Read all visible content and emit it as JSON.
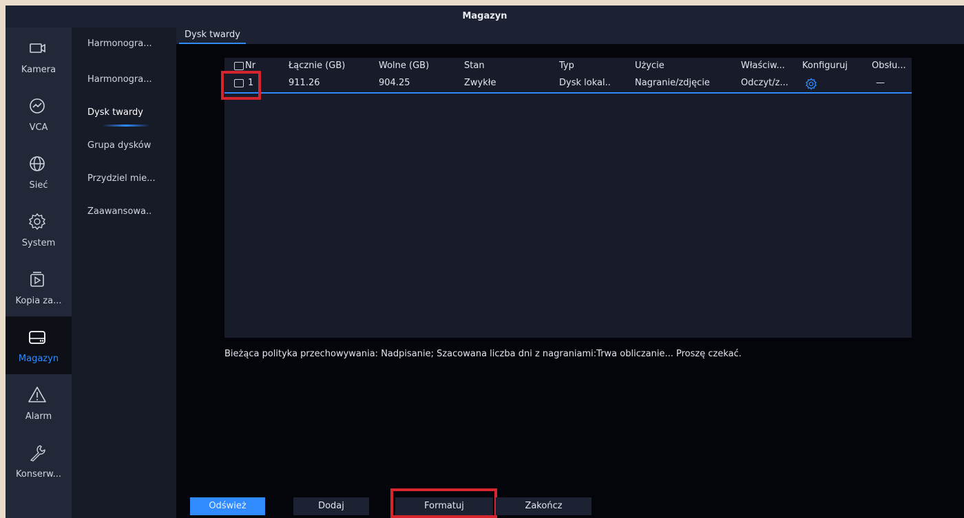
{
  "window": {
    "title": "Magazyn"
  },
  "sidebar": {
    "items": [
      {
        "label": "Kamera",
        "icon": "camera-icon"
      },
      {
        "label": "VCA",
        "icon": "vca-icon"
      },
      {
        "label": "Sieć",
        "icon": "globe-icon"
      },
      {
        "label": "System",
        "icon": "gear-icon"
      },
      {
        "label": "Kopia za...",
        "icon": "backup-play-icon"
      },
      {
        "label": "Magazyn",
        "icon": "hard-drive-icon",
        "active": true
      },
      {
        "label": "Alarm",
        "icon": "warning-triangle-icon"
      },
      {
        "label": "Konserw...",
        "icon": "wrench-icon"
      }
    ]
  },
  "submenu": {
    "items": [
      {
        "label": "Harmonogra..."
      },
      {
        "label": "Harmonogra..."
      },
      {
        "label": "Dysk twardy",
        "active": true
      },
      {
        "label": "Grupa dysków"
      },
      {
        "label": "Przydziel mie..."
      },
      {
        "label": "Zaawansowa.."
      }
    ]
  },
  "tabs": [
    {
      "label": "Dysk twardy",
      "active": true
    }
  ],
  "table": {
    "columns": [
      "Nr",
      "Łącznie (GB)",
      "Wolne (GB)",
      "Stan",
      "Typ",
      "Użycie",
      "Właściw...",
      "Konfiguruj",
      "Obsłu..."
    ],
    "rows": [
      {
        "nr": "1",
        "total": "911.26",
        "free": "904.25",
        "status": "Zwykłe",
        "type": "Dysk lokal..",
        "usage": "Nagranie/zdjęcie",
        "property": "Odczyt/z...",
        "configure_icon": "gear-icon",
        "service": "—"
      }
    ]
  },
  "policy_text": "Bieżąca polityka przechowywania: Nadpisanie; Szacowana liczba dni z nagraniami:Trwa obliczanie... Proszę czekać.",
  "buttons": {
    "refresh": "Odśwież",
    "add": "Dodaj",
    "format": "Formatuj",
    "close": "Zakończ"
  },
  "colors": {
    "accent": "#2f8bff",
    "highlight": "#d7252d",
    "background": "#03050a",
    "sidebar": "#232838"
  }
}
